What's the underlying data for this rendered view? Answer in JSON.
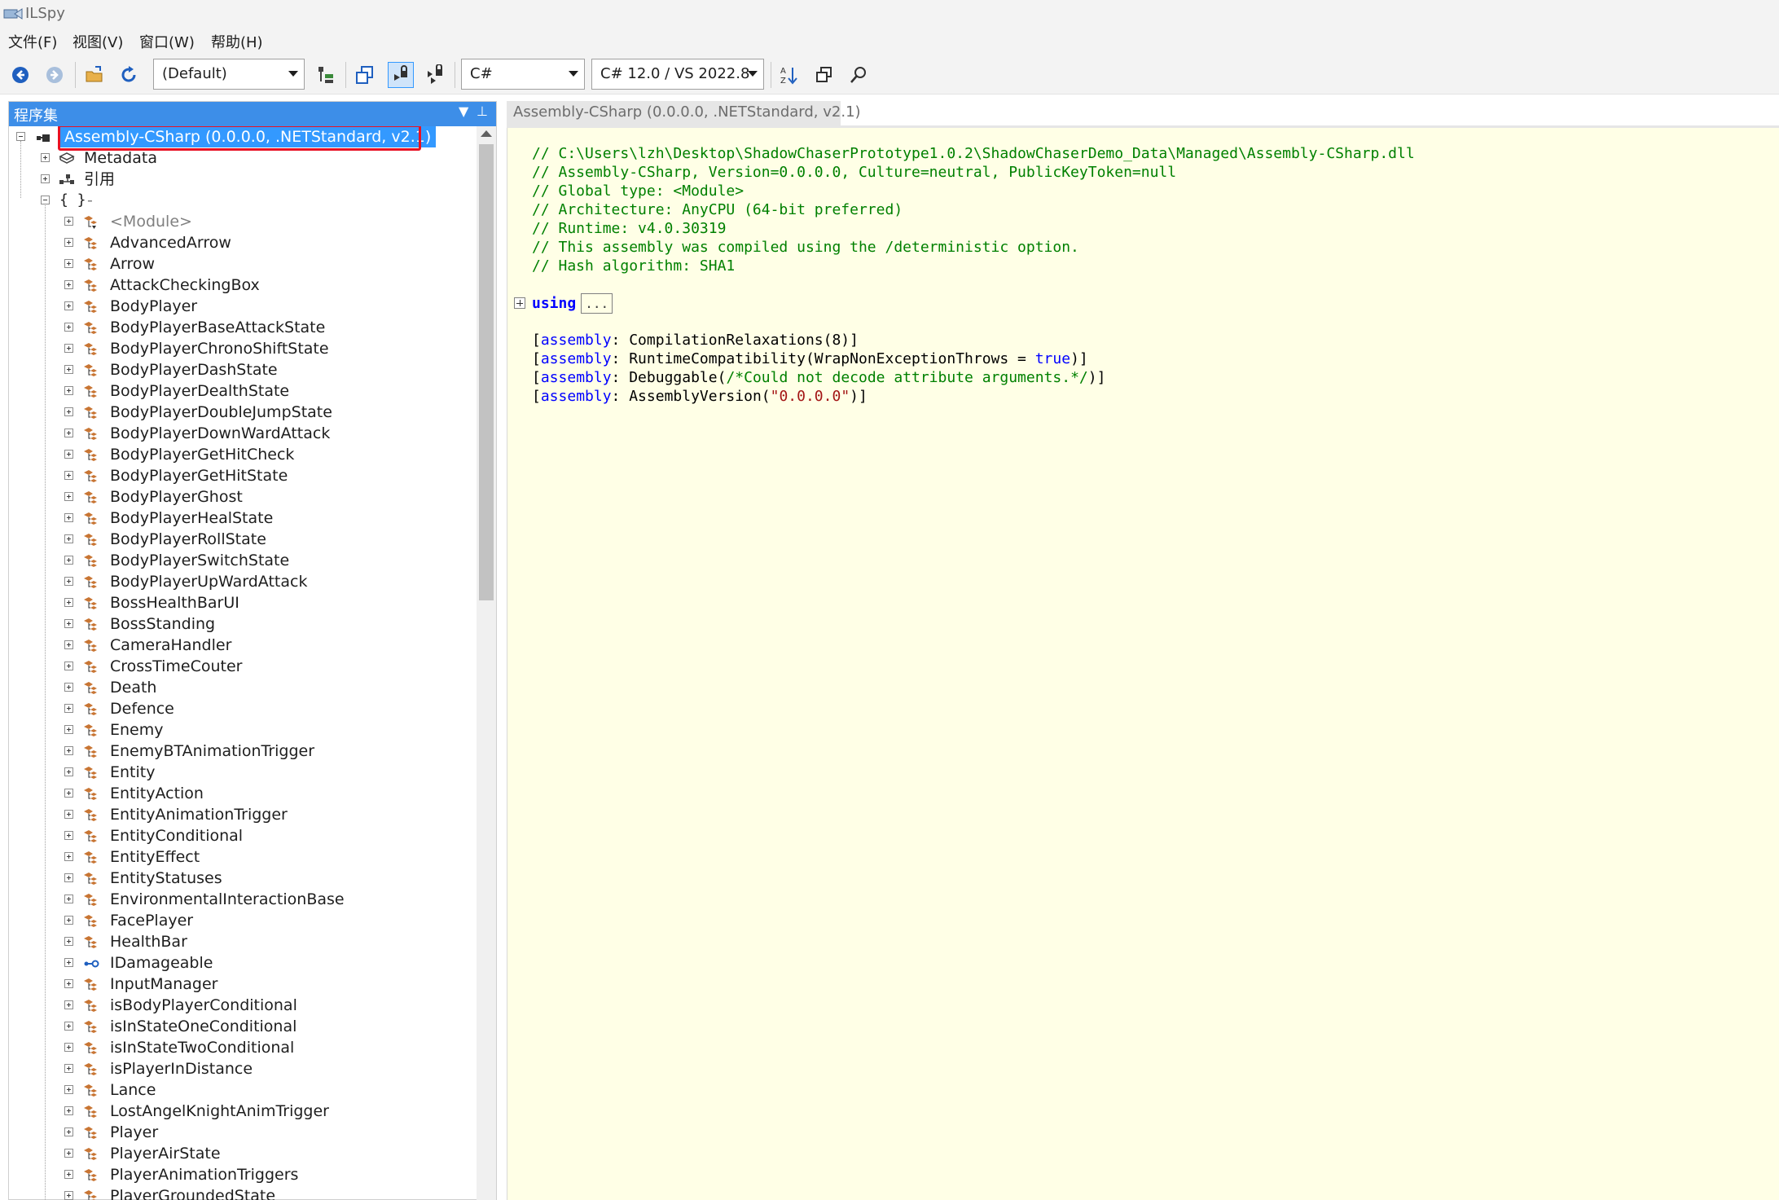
{
  "window": {
    "title": "ILSpy"
  },
  "menu": [
    "文件(F)",
    "视图(V)",
    "窗口(W)",
    "帮助(H)"
  ],
  "toolbar": {
    "assembly_list": "(Default)",
    "language": "C#",
    "language_version": "C# 12.0 / VS 2022.8"
  },
  "assemblies_pane": {
    "title": "程序集",
    "root": "Assembly-CSharp (0.0.0.0, .NETStandard, v2.1)",
    "children": [
      "Metadata",
      "引用"
    ],
    "namespace": {
      "name": "{ }",
      "suffix": "-"
    },
    "types": [
      {
        "name": "<Module>",
        "kind": "module"
      },
      {
        "name": "AdvancedArrow",
        "kind": "class"
      },
      {
        "name": "Arrow",
        "kind": "class"
      },
      {
        "name": "AttackCheckingBox",
        "kind": "class"
      },
      {
        "name": "BodyPlayer",
        "kind": "class"
      },
      {
        "name": "BodyPlayerBaseAttackState",
        "kind": "class"
      },
      {
        "name": "BodyPlayerChronoShiftState",
        "kind": "class"
      },
      {
        "name": "BodyPlayerDashState",
        "kind": "class"
      },
      {
        "name": "BodyPlayerDealthState",
        "kind": "class"
      },
      {
        "name": "BodyPlayerDoubleJumpState",
        "kind": "class"
      },
      {
        "name": "BodyPlayerDownWardAttack",
        "kind": "class"
      },
      {
        "name": "BodyPlayerGetHitCheck",
        "kind": "class"
      },
      {
        "name": "BodyPlayerGetHitState",
        "kind": "class"
      },
      {
        "name": "BodyPlayerGhost",
        "kind": "class"
      },
      {
        "name": "BodyPlayerHealState",
        "kind": "class"
      },
      {
        "name": "BodyPlayerRollState",
        "kind": "class"
      },
      {
        "name": "BodyPlayerSwitchState",
        "kind": "class"
      },
      {
        "name": "BodyPlayerUpWardAttack",
        "kind": "class"
      },
      {
        "name": "BossHealthBarUI",
        "kind": "class"
      },
      {
        "name": "BossStanding",
        "kind": "class"
      },
      {
        "name": "CameraHandler",
        "kind": "class"
      },
      {
        "name": "CrossTimeCouter",
        "kind": "class"
      },
      {
        "name": "Death",
        "kind": "class"
      },
      {
        "name": "Defence",
        "kind": "class"
      },
      {
        "name": "Enemy",
        "kind": "class"
      },
      {
        "name": "EnemyBTAnimationTrigger",
        "kind": "class"
      },
      {
        "name": "Entity",
        "kind": "class"
      },
      {
        "name": "EntityAction",
        "kind": "class"
      },
      {
        "name": "EntityAnimationTrigger",
        "kind": "class"
      },
      {
        "name": "EntityConditional",
        "kind": "class"
      },
      {
        "name": "EntityEffect",
        "kind": "class"
      },
      {
        "name": "EntityStatuses",
        "kind": "class"
      },
      {
        "name": "EnvironmentalInteractionBase",
        "kind": "class"
      },
      {
        "name": "FacePlayer",
        "kind": "class"
      },
      {
        "name": "HealthBar",
        "kind": "class"
      },
      {
        "name": "IDamageable",
        "kind": "interface"
      },
      {
        "name": "InputManager",
        "kind": "class"
      },
      {
        "name": "isBodyPlayerConditional",
        "kind": "class"
      },
      {
        "name": "isInStateOneConditional",
        "kind": "class"
      },
      {
        "name": "isInStateTwoConditional",
        "kind": "class"
      },
      {
        "name": "isPlayerInDistance",
        "kind": "class"
      },
      {
        "name": "Lance",
        "kind": "class"
      },
      {
        "name": "LostAngelKnightAnimTrigger",
        "kind": "class"
      },
      {
        "name": "Player",
        "kind": "class"
      },
      {
        "name": "PlayerAirState",
        "kind": "class"
      },
      {
        "name": "PlayerAnimationTriggers",
        "kind": "class"
      },
      {
        "name": "PlayerGroundedState",
        "kind": "class"
      }
    ]
  },
  "document_tab": {
    "label": "Assembly-CSharp (0.0.0.0, .NETStandard, v2.1)"
  },
  "code": {
    "comments": [
      "// C:\\Users\\lzh\\Desktop\\ShadowChaserPrototype1.0.2\\ShadowChaserDemo_Data\\Managed\\Assembly-CSharp.dll",
      "// Assembly-CSharp, Version=0.0.0.0, Culture=neutral, PublicKeyToken=null",
      "// Global type: <Module>",
      "// Architecture: AnyCPU (64-bit preferred)",
      "// Runtime: v4.0.30319",
      "// This assembly was compiled using the /deterministic option.",
      "// Hash algorithm: SHA1"
    ],
    "using_keyword": "using",
    "using_collapsed": "...",
    "attributes": {
      "a1_open": "[",
      "a1_kw": "assembly",
      "a1_rest": ": CompilationRelaxations(8)]",
      "a2_open": "[",
      "a2_kw": "assembly",
      "a2_mid": ": RuntimeCompatibility(WrapNonExceptionThrows = ",
      "a2_true": "true",
      "a2_end": ")]",
      "a3_open": "[",
      "a3_kw": "assembly",
      "a3_mid": ": Debuggable(",
      "a3_comment": "/*Could not decode attribute arguments.*/",
      "a3_end": ")]",
      "a4_open": "[",
      "a4_kw": "assembly",
      "a4_mid": ": AssemblyVersion(",
      "a4_str": "\"0.0.0.0\"",
      "a4_end": ")]"
    }
  },
  "colors": {
    "selection": "#3399ff",
    "pane_header": "#3d8ee8",
    "code_background": "#ffffe6",
    "comment": "#008000",
    "keyword": "#0000ff",
    "string": "#a31515",
    "highlight_box": "#e81123"
  }
}
